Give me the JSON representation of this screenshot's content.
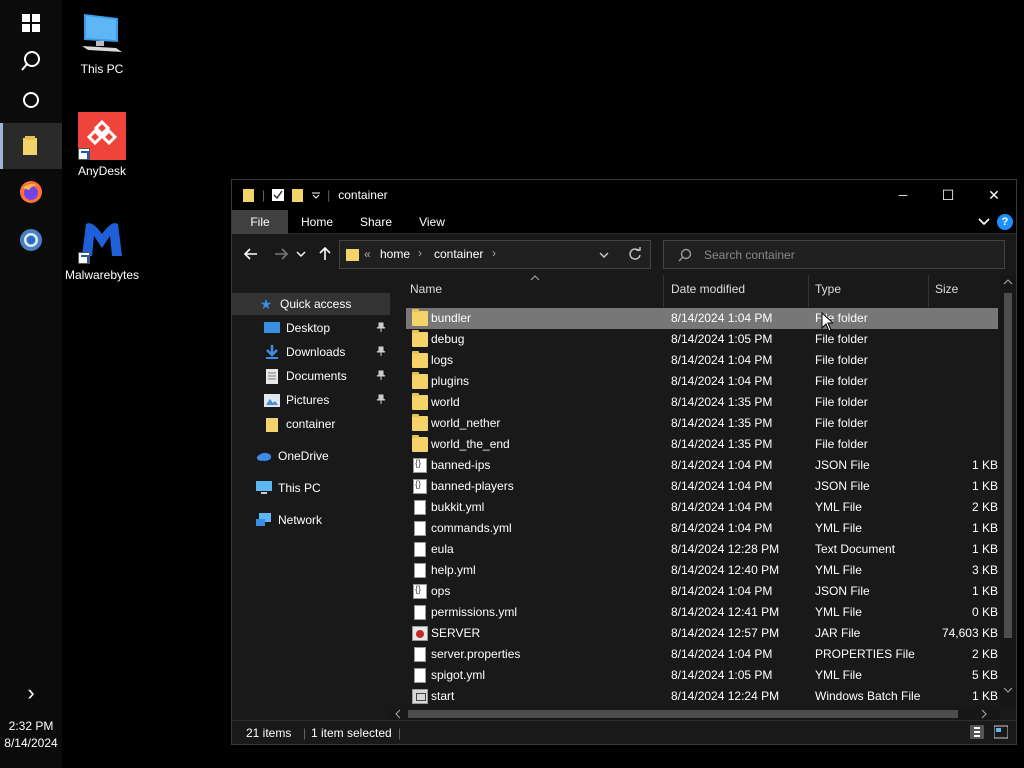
{
  "desktop": {
    "icons": [
      {
        "label": "This PC",
        "icon": "monitor-icon"
      },
      {
        "label": "AnyDesk",
        "icon": "anydesk-icon"
      },
      {
        "label": "Malwarebytes",
        "icon": "malwarebytes-icon"
      }
    ]
  },
  "taskbar": {
    "time": "2:32 PM",
    "date": "8/14/2024",
    "expand_glyph": "›"
  },
  "window": {
    "title": "container",
    "minimize_glyph": "─",
    "maximize_glyph": "☐",
    "close_glyph": "✕",
    "ribbon_tabs": [
      "File",
      "Home",
      "Share",
      "View"
    ],
    "help_glyph": "?",
    "address": {
      "overflow": "«",
      "crumbs": [
        "home",
        "container"
      ],
      "separator": "›"
    },
    "search_placeholder": "Search container",
    "nav": {
      "quick_access": "Quick access",
      "items": [
        {
          "label": "Desktop",
          "pinned": true
        },
        {
          "label": "Downloads",
          "pinned": true
        },
        {
          "label": "Documents",
          "pinned": true
        },
        {
          "label": "Pictures",
          "pinned": true
        },
        {
          "label": "container",
          "pinned": false
        }
      ],
      "onedrive": "OneDrive",
      "thispc": "This PC",
      "network": "Network"
    },
    "columns": [
      "Name",
      "Date modified",
      "Type",
      "Size"
    ],
    "files": [
      {
        "name": "bundler",
        "date": "8/14/2024 1:04 PM",
        "type": "File folder",
        "size": "",
        "kind": "folder",
        "selected": true
      },
      {
        "name": "debug",
        "date": "8/14/2024 1:05 PM",
        "type": "File folder",
        "size": "",
        "kind": "folder"
      },
      {
        "name": "logs",
        "date": "8/14/2024 1:04 PM",
        "type": "File folder",
        "size": "",
        "kind": "folder"
      },
      {
        "name": "plugins",
        "date": "8/14/2024 1:04 PM",
        "type": "File folder",
        "size": "",
        "kind": "folder"
      },
      {
        "name": "world",
        "date": "8/14/2024 1:35 PM",
        "type": "File folder",
        "size": "",
        "kind": "folder"
      },
      {
        "name": "world_nether",
        "date": "8/14/2024 1:35 PM",
        "type": "File folder",
        "size": "",
        "kind": "folder"
      },
      {
        "name": "world_the_end",
        "date": "8/14/2024 1:35 PM",
        "type": "File folder",
        "size": "",
        "kind": "folder"
      },
      {
        "name": "banned-ips",
        "date": "8/14/2024 1:04 PM",
        "type": "JSON File",
        "size": "1 KB",
        "kind": "json"
      },
      {
        "name": "banned-players",
        "date": "8/14/2024 1:04 PM",
        "type": "JSON File",
        "size": "1 KB",
        "kind": "json"
      },
      {
        "name": "bukkit.yml",
        "date": "8/14/2024 1:04 PM",
        "type": "YML File",
        "size": "2 KB",
        "kind": "doc"
      },
      {
        "name": "commands.yml",
        "date": "8/14/2024 1:04 PM",
        "type": "YML File",
        "size": "1 KB",
        "kind": "doc"
      },
      {
        "name": "eula",
        "date": "8/14/2024 12:28 PM",
        "type": "Text Document",
        "size": "1 KB",
        "kind": "doc"
      },
      {
        "name": "help.yml",
        "date": "8/14/2024 12:40 PM",
        "type": "YML File",
        "size": "3 KB",
        "kind": "doc"
      },
      {
        "name": "ops",
        "date": "8/14/2024 1:04 PM",
        "type": "JSON File",
        "size": "1 KB",
        "kind": "json"
      },
      {
        "name": "permissions.yml",
        "date": "8/14/2024 12:41 PM",
        "type": "YML File",
        "size": "0 KB",
        "kind": "doc"
      },
      {
        "name": "SERVER",
        "date": "8/14/2024 12:57 PM",
        "type": "JAR File",
        "size": "74,603 KB",
        "kind": "jar"
      },
      {
        "name": "server.properties",
        "date": "8/14/2024 1:04 PM",
        "type": "PROPERTIES File",
        "size": "2 KB",
        "kind": "doc"
      },
      {
        "name": "spigot.yml",
        "date": "8/14/2024 1:05 PM",
        "type": "YML File",
        "size": "5 KB",
        "kind": "doc"
      },
      {
        "name": "start",
        "date": "8/14/2024 12:24 PM",
        "type": "Windows Batch File",
        "size": "1 KB",
        "kind": "bat"
      }
    ],
    "status": {
      "items": "21 items",
      "selected": "1 item selected"
    }
  },
  "colors": {
    "folder": "#f5d36b",
    "selection": "#777777",
    "accent": "#1e90ff"
  }
}
